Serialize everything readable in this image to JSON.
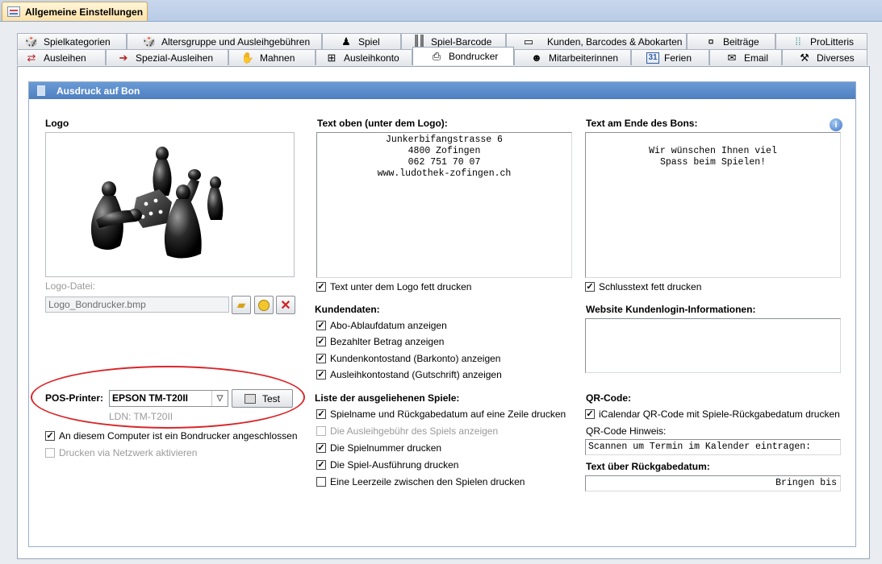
{
  "window": {
    "tab_title": "Allgemeine Einstellungen"
  },
  "tabs_row1": [
    {
      "label": "Spielkategorien",
      "icon": "dice-icon"
    },
    {
      "label": "Altersgruppe und Ausleihgebühren",
      "icon": "dice-icon"
    },
    {
      "label": "Spiel",
      "icon": "game-pieces-icon"
    },
    {
      "label": "Spiel-Barcode",
      "icon": "barcode-icon"
    },
    {
      "label": "Kunden, Barcodes & Abokarten",
      "icon": "id-card-icon"
    },
    {
      "label": "Beiträge",
      "icon": "money-icon"
    },
    {
      "label": "ProLitteris",
      "icon": "dots-icon"
    }
  ],
  "tabs_row2": [
    {
      "label": "Ausleihen",
      "icon": "arrows-icon"
    },
    {
      "label": "Spezial-Ausleihen",
      "icon": "arrow-right-icon"
    },
    {
      "label": "Mahnen",
      "icon": "reminder-icon"
    },
    {
      "label": "Ausleihkonto",
      "icon": "account-add-icon"
    },
    {
      "label": "Bondrucker",
      "icon": "printer-icon"
    },
    {
      "label": "Mitarbeiterinnen",
      "icon": "user-icon"
    },
    {
      "label": "Ferien",
      "icon": "calendar-icon"
    },
    {
      "label": "Email",
      "icon": "envelope-icon"
    },
    {
      "label": "Diverses",
      "icon": "tools-icon"
    }
  ],
  "section": {
    "title": "Ausdruck auf Bon"
  },
  "logo": {
    "heading": "Logo",
    "file_label": "Logo-Datei:",
    "file_value": "Logo_Bondrucker.bmp"
  },
  "printer": {
    "label": "POS-Printer:",
    "value": "EPSON TM-T20II",
    "test_button": "Test",
    "ldn": "LDN: TM-T20II",
    "connected_label": "An diesem Computer ist ein Bondrucker angeschlossen",
    "connected_checked": true,
    "network_label": "Drucken via Netzwerk aktivieren",
    "network_checked": false
  },
  "text_top": {
    "heading": "Text oben (unter dem Logo):",
    "content": "Junkerbifangstrasse 6\n4800 Zofingen\n062 751 70 07\nwww.ludothek-zofingen.ch",
    "bold_label": "Text unter dem Logo fett drucken",
    "bold_checked": true
  },
  "text_end": {
    "heading": "Text am Ende des Bons:",
    "content": "Wir wünschen Ihnen viel\nSpass beim Spielen!",
    "bold_label": "Schlusstext fett drucken",
    "bold_checked": true
  },
  "kundendaten": {
    "heading": "Kundendaten:",
    "items": [
      {
        "label": "Abo-Ablaufdatum anzeigen",
        "checked": true
      },
      {
        "label": "Bezahlter Betrag anzeigen",
        "checked": true
      },
      {
        "label": "Kundenkontostand (Barkonto) anzeigen",
        "checked": true
      },
      {
        "label": "Ausleihkontostand (Gutschrift) anzeigen",
        "checked": true
      }
    ]
  },
  "spiele": {
    "heading": "Liste der ausgeliehenen Spiele:",
    "items": [
      {
        "label": "Spielname und Rückgabedatum auf eine Zeile drucken",
        "checked": true,
        "disabled": false
      },
      {
        "label": "Die Ausleihgebühr des Spiels anzeigen",
        "checked": false,
        "disabled": true
      },
      {
        "label": "Die Spielnummer drucken",
        "checked": true,
        "disabled": false
      },
      {
        "label": "Die Spiel-Ausführung drucken",
        "checked": true,
        "disabled": false
      },
      {
        "label": "Eine Leerzeile zwischen den Spielen drucken",
        "checked": false,
        "disabled": false
      }
    ]
  },
  "website": {
    "heading": "Website Kundenlogin-Informationen:",
    "content": ""
  },
  "qr": {
    "heading": "QR-Code:",
    "ical_label": "iCalendar QR-Code mit Spiele-Rückgabedatum drucken",
    "ical_checked": true,
    "hint_label": "QR-Code Hinweis:",
    "hint_value": "Scannen um Termin im Kalender eintragen:",
    "return_heading": "Text über Rückgabedatum:",
    "return_value": "Bringen bis"
  }
}
